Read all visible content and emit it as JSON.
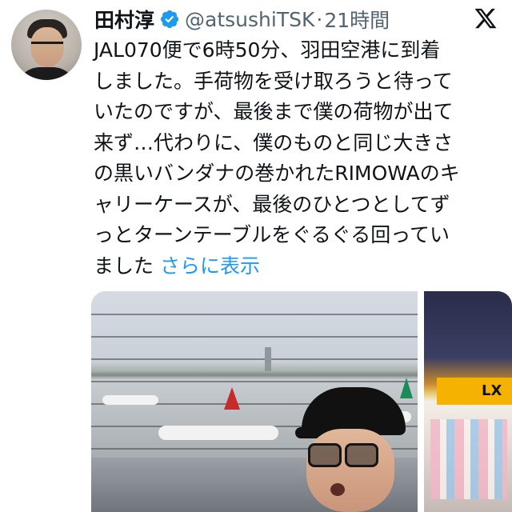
{
  "tweet": {
    "author_name": "田村淳",
    "handle": "@atsushiTSK",
    "separator": "·",
    "time_ago": "21時間",
    "body_text": "JAL070便で6時50分、羽田空港に到着\nしました。手荷物を受け取ろうと待って\nいたのですが、最後まで僕の荷物が出て\n来ず…代わりに、僕のものと同じ大きさ\nの黒いバンダナの巻かれたRIMOWAのキ\nャリーケースが、最後のひとつとしてず\nっとターンテーブルをぐるぐる回ってい\nました",
    "show_more": "さらに表示",
    "photo_sign_text": "LX"
  },
  "icons": {
    "verified": "verified-badge-icon",
    "platform": "x-logo-icon"
  },
  "colors": {
    "accent": "#1d9bf0",
    "secondary_text": "#536471",
    "primary_text": "#0f1419"
  }
}
